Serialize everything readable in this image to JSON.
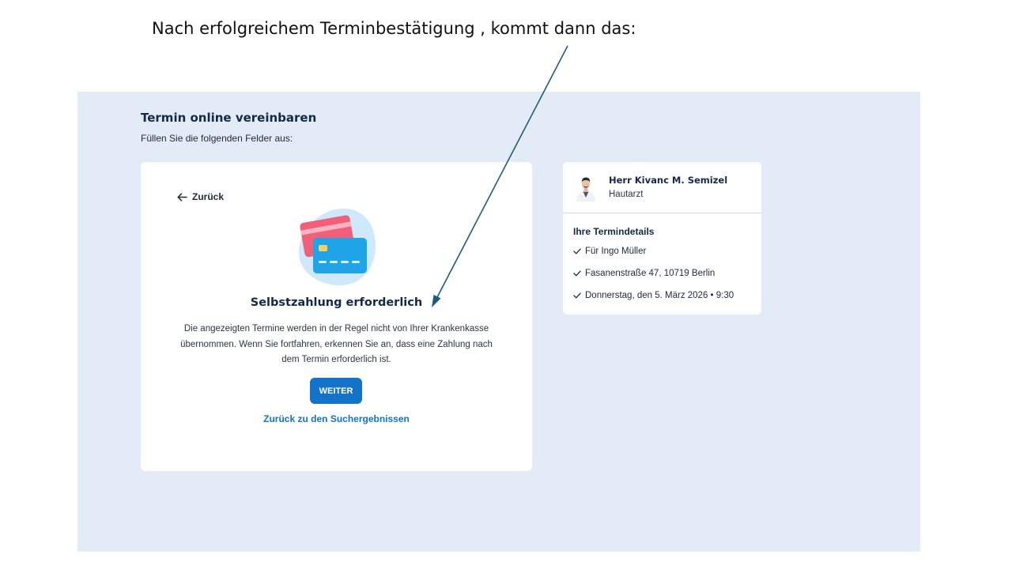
{
  "annotation": {
    "caption": "Nach erfolgreichem Terminbestätigung , kommt dann das:",
    "arrow_color": "#1f5c7a"
  },
  "page": {
    "title": "Termin online vereinbaren",
    "subtitle": "Füllen Sie die folgenden Felder aus:",
    "background_color": "#e3ecf6"
  },
  "payment_card": {
    "back_label": "Zurück",
    "back_icon": "arrow-left-icon",
    "illustration_icon": "credit-cards-icon",
    "heading": "Selbstzahlung erforderlich",
    "text": "Die angezeigten Termine werden in der Regel nicht von Ihrer Krankenkasse übernommen. Wenn Sie fortfahren, erkennen Sie an, dass eine Zahlung nach dem Termin erforderlich ist.",
    "continue_label": "WEITER",
    "results_link": "Zurück zu den Suchergebnissen",
    "accent_color": "#1273c8"
  },
  "doctor": {
    "name": "Herr Kivanc M. Semizel",
    "specialty": "Hautarzt",
    "avatar_icon": "doctor-avatar"
  },
  "appointment": {
    "title": "Ihre Termindetails",
    "items": [
      {
        "icon": "check-icon",
        "text": "Für Ingo Müller"
      },
      {
        "icon": "check-icon",
        "text": "Fasanenstraße 47, 10719 Berlin"
      },
      {
        "icon": "check-icon",
        "text": "Donnerstag, den 5. März 2026 • 9:30"
      }
    ]
  }
}
